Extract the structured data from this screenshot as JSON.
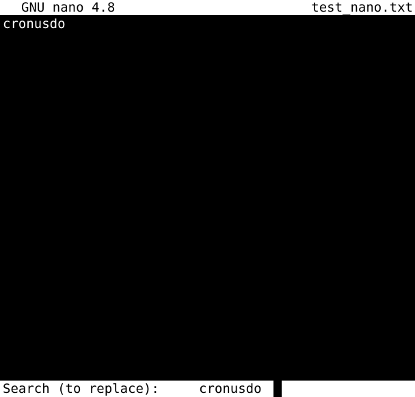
{
  "title_bar": {
    "app_name": "GNU nano 4.8",
    "file_name": "test_nano.txt"
  },
  "buffer": {
    "lines": [
      "cronusdo"
    ]
  },
  "prompt": {
    "label": "Search (to replace):",
    "value": "cronusdo"
  },
  "colors": {
    "background": "#000000",
    "foreground": "#ffffff",
    "bar_background": "#ffffff",
    "bar_foreground": "#000000"
  }
}
